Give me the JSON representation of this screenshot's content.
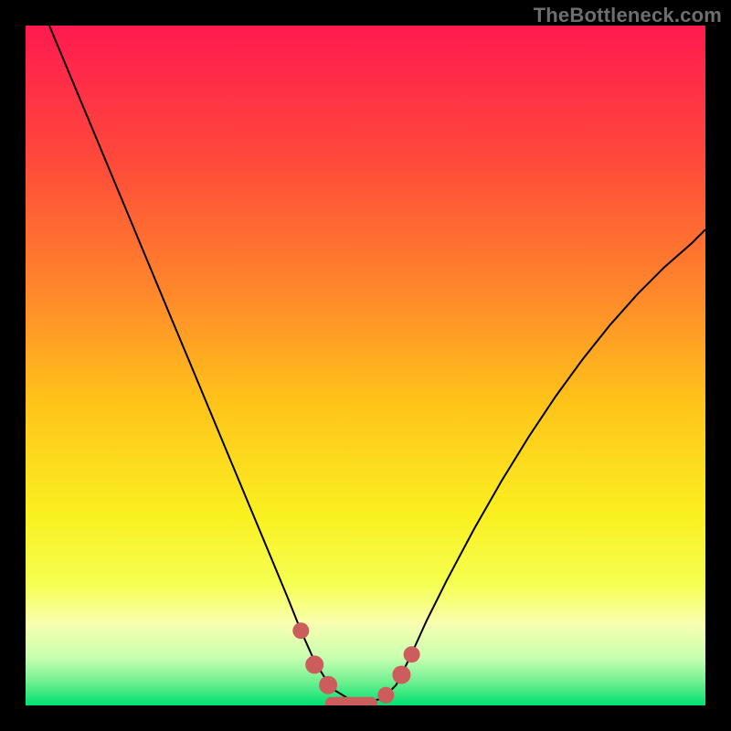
{
  "watermark": "TheBottleneck.com",
  "chart_data": {
    "type": "line",
    "title": "",
    "xlabel": "",
    "ylabel": "",
    "xlim": [
      0,
      1
    ],
    "ylim": [
      0,
      1
    ],
    "grid": false,
    "legend": false,
    "background": {
      "gradient_stops": [
        {
          "pos": 0.0,
          "color": "#ff1a50"
        },
        {
          "pos": 0.2,
          "color": "#ff4a3a"
        },
        {
          "pos": 0.4,
          "color": "#ff8a2a"
        },
        {
          "pos": 0.55,
          "color": "#ffc21a"
        },
        {
          "pos": 0.72,
          "color": "#faf020"
        },
        {
          "pos": 0.82,
          "color": "#f5ff50"
        },
        {
          "pos": 0.88,
          "color": "#f9ffb0"
        },
        {
          "pos": 0.93,
          "color": "#c8ffb0"
        },
        {
          "pos": 0.965,
          "color": "#70f090"
        },
        {
          "pos": 1.0,
          "color": "#00e070"
        }
      ]
    },
    "series": [
      {
        "name": "bottleneck-curve",
        "x": [
          0.035,
          0.06,
          0.09,
          0.12,
          0.15,
          0.18,
          0.21,
          0.24,
          0.27,
          0.3,
          0.33,
          0.36,
          0.385,
          0.405,
          0.425,
          0.45,
          0.475,
          0.5,
          0.525,
          0.545,
          0.565,
          0.59,
          0.62,
          0.66,
          0.7,
          0.74,
          0.78,
          0.82,
          0.86,
          0.9,
          0.94,
          0.98,
          1.0
        ],
        "y": [
          1.0,
          0.94,
          0.868,
          0.796,
          0.724,
          0.652,
          0.58,
          0.508,
          0.436,
          0.364,
          0.292,
          0.22,
          0.16,
          0.11,
          0.065,
          0.025,
          0.01,
          0.005,
          0.01,
          0.03,
          0.07,
          0.125,
          0.185,
          0.26,
          0.33,
          0.395,
          0.455,
          0.51,
          0.56,
          0.605,
          0.645,
          0.68,
          0.7
        ]
      }
    ],
    "markers": {
      "name": "optimal-region-dots",
      "color": "#cd5c5c",
      "points": [
        {
          "x": 0.405,
          "y": 0.11,
          "r": 9
        },
        {
          "x": 0.425,
          "y": 0.06,
          "r": 10
        },
        {
          "x": 0.445,
          "y": 0.03,
          "r": 10
        },
        {
          "x": 0.53,
          "y": 0.015,
          "r": 9
        },
        {
          "x": 0.553,
          "y": 0.045,
          "r": 10
        },
        {
          "x": 0.568,
          "y": 0.075,
          "r": 9
        }
      ],
      "flat_segment": {
        "x0": 0.45,
        "x1": 0.508,
        "y": 0.003
      }
    }
  }
}
